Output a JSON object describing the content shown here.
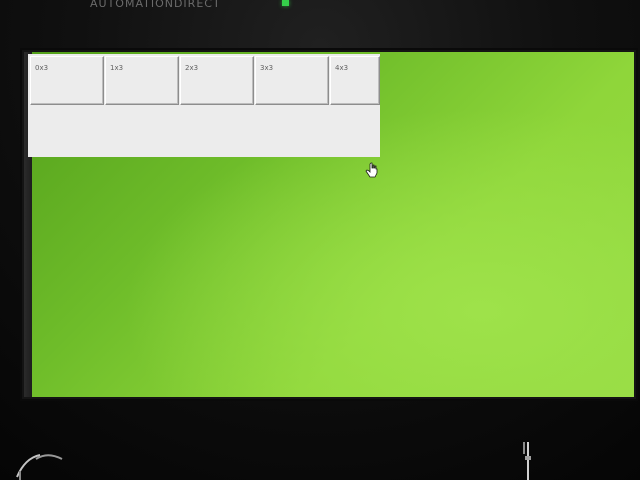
{
  "bezel": {
    "brand": "AUTOMATIONDIRECT"
  },
  "panel": {
    "cells": [
      {
        "label": "0x3"
      },
      {
        "label": "1x3"
      },
      {
        "label": "2x3"
      },
      {
        "label": "3x3"
      },
      {
        "label": "4x3"
      }
    ]
  },
  "colors": {
    "screen_background": "#78c42f",
    "panel_background": "#ececec",
    "cell_text": "#616161",
    "led": "#35d04a"
  },
  "icons": {
    "cursor": "touch-hand-cursor-icon"
  }
}
